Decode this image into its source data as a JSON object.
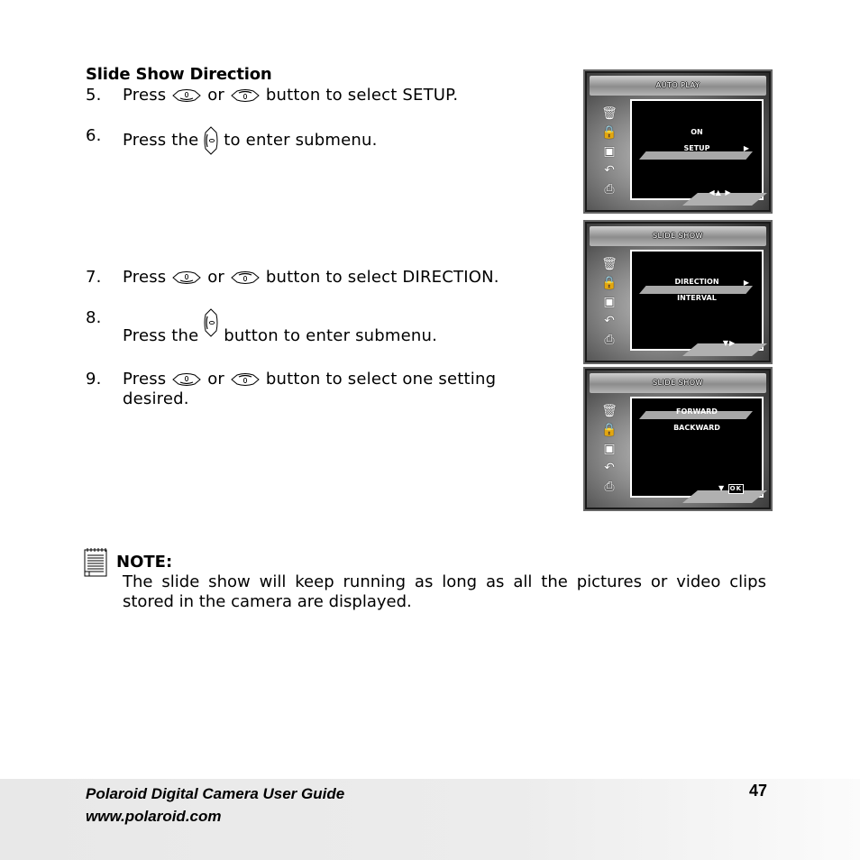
{
  "section": {
    "heading": "Slide Show Direction"
  },
  "steps": [
    {
      "num": "5.",
      "pre": "Press",
      "mid": "or",
      "post": "button to select SETUP.",
      "icons": [
        "up-button-icon",
        "down-button-icon"
      ]
    },
    {
      "num": "6.",
      "pre": "Press the",
      "post": "to enter submenu.",
      "icons": [
        "right-button-icon"
      ]
    },
    {
      "num": "7.",
      "pre": "Press",
      "mid": "or",
      "post": "button to select DIRECTION.",
      "icons": [
        "up-button-icon",
        "down-button-icon"
      ]
    },
    {
      "num": "8.",
      "pre": "Press the",
      "post": "button to enter submenu.",
      "icons": [
        "right-button-icon"
      ]
    },
    {
      "num": "9.",
      "pre": "Press",
      "mid": "or",
      "post": "button to select one setting desired.",
      "icons": [
        "up-button-icon",
        "down-button-icon"
      ]
    }
  ],
  "panels": [
    {
      "title": "AUTO PLAY",
      "options": [
        "ON",
        "SETUP"
      ],
      "selected": "SETUP",
      "nav_hint": "◀▲  ▶",
      "side_icons": [
        "trash-icon",
        "lock-icon",
        "slideshow-icon",
        "rotate-icon",
        "print-icon"
      ]
    },
    {
      "title": "SLIDE SHOW",
      "options": [
        "DIRECTION",
        "INTERVAL"
      ],
      "selected": "DIRECTION",
      "nav_hint": "▼▶",
      "side_icons": [
        "trash-icon",
        "lock-icon",
        "slideshow-icon",
        "rotate-icon",
        "print-icon"
      ]
    },
    {
      "title": "SLIDE SHOW",
      "options": [
        "FORWARD",
        "BACKWARD"
      ],
      "selected": "FORWARD",
      "nav_hint": "▼",
      "ok_label": "OK",
      "side_icons": [
        "trash-icon",
        "lock-icon",
        "slideshow-icon",
        "rotate-icon",
        "print-icon"
      ]
    }
  ],
  "note": {
    "title": "NOTE:",
    "body": "The slide show will keep running as long as all the pictures or video clips stored in the camera are displayed."
  },
  "footer": {
    "title": "Polaroid Digital Camera User Guide",
    "url": "www.polaroid.com",
    "page_number": "47"
  }
}
